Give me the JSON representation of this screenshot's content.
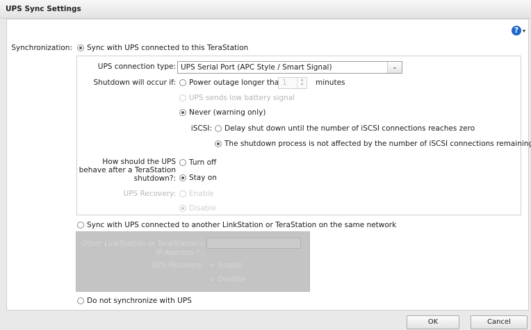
{
  "window": {
    "title": "UPS Sync Settings"
  },
  "help": {
    "icon": "help-icon",
    "glyph": "?",
    "caret": "▾"
  },
  "sync": {
    "label": "Synchronization:",
    "option_this": "Sync with UPS connected to this TeraStation",
    "option_other": "Sync with UPS connected to another LinkStation or TeraStation on the same network",
    "option_none": "Do not synchronize with UPS"
  },
  "ups": {
    "connection_type_label": "UPS connection type:",
    "connection_type_value": "UPS Serial Port (APC Style / Smart Signal)",
    "dropdown_glyph": "⌄",
    "shutdown_label": "Shutdown will occur if:",
    "power_outage_label": "Power outage longer than",
    "minutes_value": "1",
    "minutes_label": "minutes",
    "low_battery_label": "UPS sends low battery signal",
    "never_label": "Never (warning only)",
    "iscsi_label": "iSCSI:",
    "iscsi_delay": "Delay shut down until the number of iSCSI connections reaches zero",
    "iscsi_not_affected": "The shutdown process is not affected by the number of iSCSI connections remaining.",
    "behave_label_line1": "How should the UPS",
    "behave_label_line2": "behave after a TeraStation",
    "behave_label_line3": "shutdown?:",
    "turn_off": "Turn off",
    "stay_on": "Stay on",
    "recovery_label": "UPS Recovery:",
    "recovery_enable": "Enable",
    "recovery_disable": "Disable"
  },
  "other": {
    "ip_label_line1": "Other LinkStation or TeraStation's",
    "ip_label_line2": "IP Address * :",
    "recovery_label": "UPS Recovery:",
    "recovery_enable": "Enable",
    "recovery_disable": "Disable"
  },
  "footer": {
    "ok": "OK",
    "cancel": "Cancel"
  }
}
